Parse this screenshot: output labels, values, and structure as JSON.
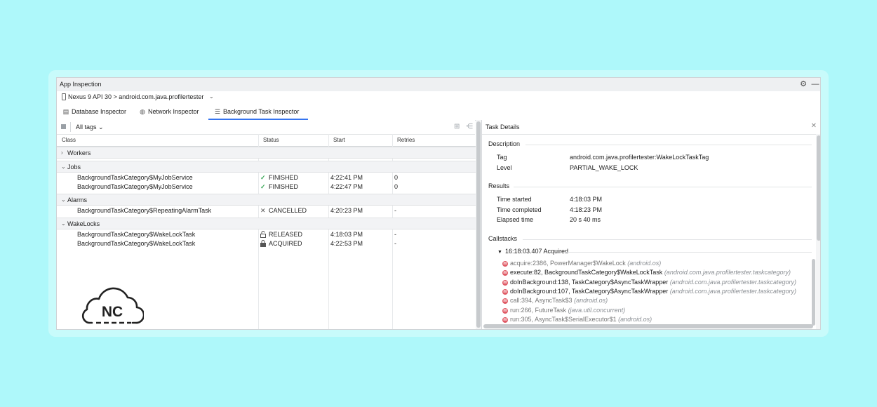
{
  "window": {
    "title": "App Inspection"
  },
  "device": {
    "label": "Nexus 9 API 30 > android.com.java.profilertester"
  },
  "tabs": [
    {
      "label": "Database Inspector",
      "icon": "database-icon"
    },
    {
      "label": "Network Inspector",
      "icon": "globe-icon"
    },
    {
      "label": "Background Task Inspector",
      "icon": "list-icon",
      "active": true
    }
  ],
  "toolbar": {
    "tags_label": "All tags"
  },
  "table": {
    "headers": [
      "Class",
      "Status",
      "Start",
      "Retries"
    ],
    "groups": [
      {
        "label": "Workers",
        "expanded": false,
        "rows": []
      },
      {
        "label": "Jobs",
        "expanded": true,
        "rows": [
          {
            "class": "BackgroundTaskCategory$MyJobService",
            "status": "FINISHED",
            "status_icon": "check-icon",
            "start": "4:22:41 PM",
            "retries": "0"
          },
          {
            "class": "BackgroundTaskCategory$MyJobService",
            "status": "FINISHED",
            "status_icon": "check-icon",
            "start": "4:22:47 PM",
            "retries": "0"
          }
        ]
      },
      {
        "label": "Alarms",
        "expanded": true,
        "rows": [
          {
            "class": "BackgroundTaskCategory$RepeatingAlarmTask",
            "status": "CANCELLED",
            "status_icon": "x-icon",
            "start": "4:20:23 PM",
            "retries": "-"
          }
        ]
      },
      {
        "label": "WakeLocks",
        "expanded": true,
        "rows": [
          {
            "class": "BackgroundTaskCategory$WakeLockTask",
            "status": "RELEASED",
            "status_icon": "unlock-icon",
            "start": "4:18:03 PM",
            "retries": "-"
          },
          {
            "class": "BackgroundTaskCategory$WakeLockTask",
            "status": "ACQUIRED",
            "status_icon": "lock-icon",
            "start": "4:22:53 PM",
            "retries": "-"
          }
        ]
      }
    ]
  },
  "logo": {
    "text": "NC"
  },
  "details": {
    "title": "Task Details",
    "description": {
      "heading": "Description",
      "tag_key": "Tag",
      "tag_value": "android.com.java.profilertester:WakeLockTaskTag",
      "level_key": "Level",
      "level_value": "PARTIAL_WAKE_LOCK"
    },
    "results": {
      "heading": "Results",
      "started_key": "Time started",
      "started_value": "4:18:03 PM",
      "completed_key": "Time completed",
      "completed_value": "4:18:23 PM",
      "elapsed_key": "Elapsed time",
      "elapsed_value": "20 s 40 ms"
    },
    "callstacks": {
      "heading": "Callstacks",
      "entry": "16:18:03.407 Acquired",
      "frames": [
        {
          "fn": "acquire:2386, PowerManager$WakeLock",
          "pkg": "(android.os)",
          "dim": true
        },
        {
          "fn": "execute:82, BackgroundTaskCategory$WakeLockTask",
          "pkg": "(android.com.java.profilertester.taskcategory)",
          "dim": false
        },
        {
          "fn": "doInBackground:138, TaskCategory$AsyncTaskWrapper",
          "pkg": "(android.com.java.profilertester.taskcategory)",
          "dim": false
        },
        {
          "fn": "doInBackground:107, TaskCategory$AsyncTaskWrapper",
          "pkg": "(android.com.java.profilertester.taskcategory)",
          "dim": false
        },
        {
          "fn": "call:394, AsyncTask$3",
          "pkg": "(android.os)",
          "dim": true
        },
        {
          "fn": "run:266, FutureTask",
          "pkg": "(java.util.concurrent)",
          "dim": true
        },
        {
          "fn": "run:305, AsyncTask$SerialExecutor$1",
          "pkg": "(android.os)",
          "dim": true
        }
      ]
    }
  }
}
